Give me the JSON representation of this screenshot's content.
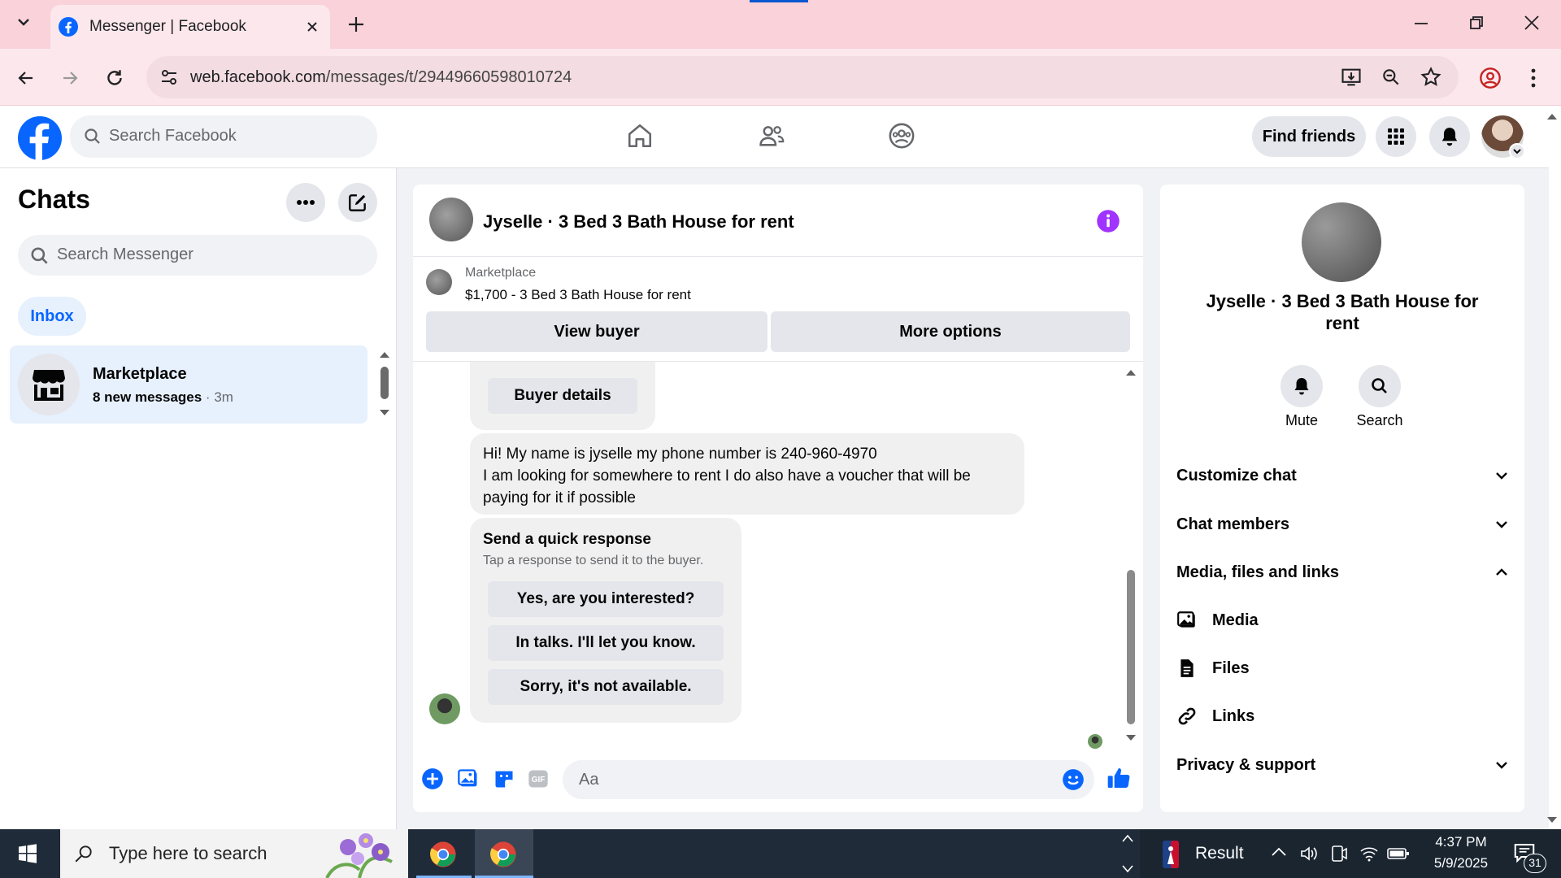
{
  "browser": {
    "tab_title": "Messenger | Facebook",
    "url_host": "web.facebook.com",
    "url_path": "/messages/t/29449660598010724"
  },
  "fb_header": {
    "search_placeholder": "Search Facebook",
    "find_friends": "Find friends"
  },
  "chats": {
    "title": "Chats",
    "search_placeholder": "Search Messenger",
    "inbox_label": "Inbox",
    "items": [
      {
        "name": "Marketplace",
        "preview": "8 new messages",
        "time": "3m"
      }
    ]
  },
  "conversation": {
    "title": "Jyselle · 3 Bed 3 Bath House for rent",
    "listing_source": "Marketplace",
    "listing_title": "$1,700 - 3 Bed 3 Bath House for rent",
    "view_buyer": "View buyer",
    "more_options": "More options",
    "buyer_details": "Buyer details",
    "message_lines": [
      "Hi! My name is jyselle my phone number is 240-960-4970",
      "I am looking for somewhere to rent I do also have a voucher that will be",
      "paying for it if possible"
    ],
    "quick_response_title": "Send a quick response",
    "quick_response_sub": "Tap a response to send it to the buyer.",
    "quick_responses": [
      "Yes, are you interested?",
      "In talks. I'll let you know.",
      "Sorry, it's not available."
    ],
    "composer_placeholder": "Aa"
  },
  "info_panel": {
    "name": "Jyselle · 3 Bed 3 Bath House for rent",
    "mute": "Mute",
    "search": "Search",
    "sections": [
      "Customize chat",
      "Chat members",
      "Media, files and links"
    ],
    "media_items": [
      "Media",
      "Files",
      "Links"
    ],
    "privacy": "Privacy & support"
  },
  "taskbar": {
    "search_placeholder": "Type here to search",
    "result_label": "Result",
    "time": "4:37 PM",
    "date": "5/9/2025",
    "notification_count": "31"
  },
  "colors": {
    "fb_blue": "#0866ff",
    "accent_purple": "#a033ff",
    "tab_bg": "#f9d2da"
  }
}
